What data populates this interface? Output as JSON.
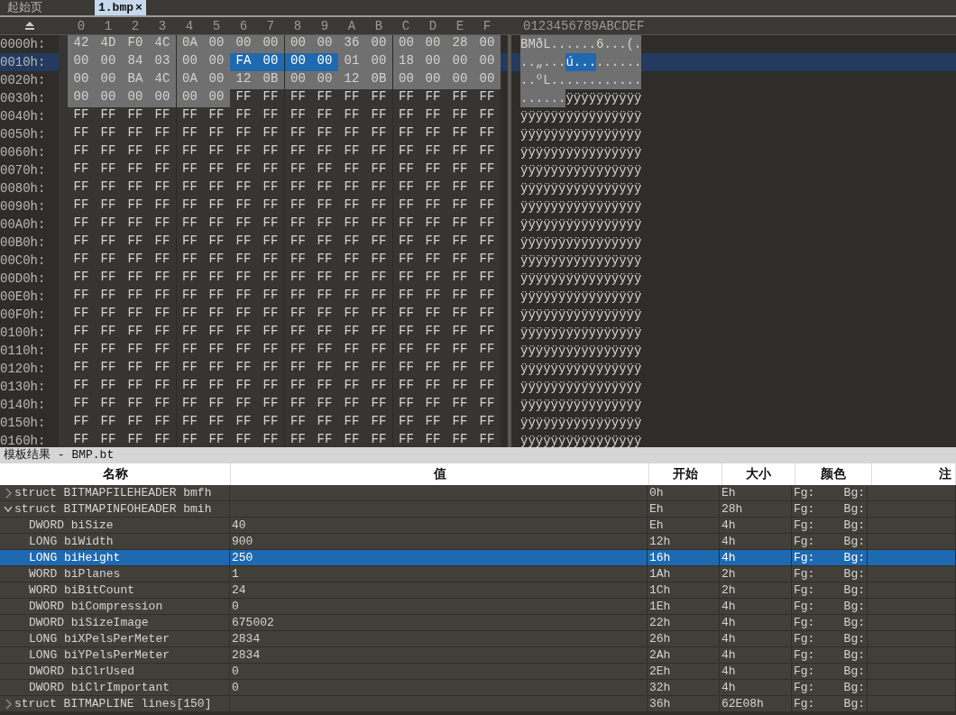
{
  "tabs": [
    {
      "label": "起始页",
      "selected": false
    },
    {
      "label": "1.bmp",
      "selected": true,
      "close": "×"
    }
  ],
  "hex_view": {
    "columns": [
      "0",
      "1",
      "2",
      "3",
      "4",
      "5",
      "6",
      "7",
      "8",
      "9",
      "A",
      "B",
      "C",
      "D",
      "E",
      "F"
    ],
    "ascii_header": "0123456789ABCDEF",
    "rows": [
      {
        "address": "0000h:",
        "current": false,
        "bytes": [
          "42",
          "4D",
          "F0",
          "4C",
          "0A",
          "00",
          "00",
          "00",
          "00",
          "00",
          "36",
          "00",
          "00",
          "00",
          "28",
          "00"
        ],
        "ascii": "BMðL......6...(.",
        "in_template": [
          true,
          true,
          true,
          true,
          true,
          true,
          true,
          true,
          true,
          true,
          true,
          true,
          true,
          true,
          true,
          true
        ],
        "selected": [
          false,
          false,
          false,
          false,
          false,
          false,
          false,
          false,
          false,
          false,
          false,
          false,
          false,
          false,
          false,
          false
        ]
      },
      {
        "address": "0010h:",
        "current": true,
        "bytes": [
          "00",
          "00",
          "84",
          "03",
          "00",
          "00",
          "FA",
          "00",
          "00",
          "00",
          "01",
          "00",
          "18",
          "00",
          "00",
          "00"
        ],
        "ascii": "..„...ú.........",
        "in_template": [
          true,
          true,
          true,
          true,
          true,
          true,
          false,
          false,
          false,
          false,
          true,
          true,
          true,
          true,
          true,
          true
        ],
        "selected": [
          false,
          false,
          false,
          false,
          false,
          false,
          true,
          true,
          true,
          true,
          false,
          false,
          false,
          false,
          false,
          false
        ]
      },
      {
        "address": "0020h:",
        "current": false,
        "bytes": [
          "00",
          "00",
          "BA",
          "4C",
          "0A",
          "00",
          "12",
          "0B",
          "00",
          "00",
          "12",
          "0B",
          "00",
          "00",
          "00",
          "00"
        ],
        "ascii": "..ºL............",
        "in_template": [
          true,
          true,
          true,
          true,
          true,
          true,
          true,
          true,
          true,
          true,
          true,
          true,
          true,
          true,
          true,
          true
        ],
        "selected": [
          false,
          false,
          false,
          false,
          false,
          false,
          false,
          false,
          false,
          false,
          false,
          false,
          false,
          false,
          false,
          false
        ]
      },
      {
        "address": "0030h:",
        "current": false,
        "bytes": [
          "00",
          "00",
          "00",
          "00",
          "00",
          "00",
          "FF",
          "FF",
          "FF",
          "FF",
          "FF",
          "FF",
          "FF",
          "FF",
          "FF",
          "FF"
        ],
        "ascii": "......ÿÿÿÿÿÿÿÿÿÿ",
        "in_template": [
          true,
          true,
          true,
          true,
          true,
          true,
          false,
          false,
          false,
          false,
          false,
          false,
          false,
          false,
          false,
          false
        ],
        "selected": [
          false,
          false,
          false,
          false,
          false,
          false,
          false,
          false,
          false,
          false,
          false,
          false,
          false,
          false,
          false,
          false
        ]
      },
      {
        "address": "0040h:",
        "current": false,
        "bytes": [
          "FF",
          "FF",
          "FF",
          "FF",
          "FF",
          "FF",
          "FF",
          "FF",
          "FF",
          "FF",
          "FF",
          "FF",
          "FF",
          "FF",
          "FF",
          "FF"
        ],
        "ascii": "ÿÿÿÿÿÿÿÿÿÿÿÿÿÿÿÿ"
      },
      {
        "address": "0050h:",
        "current": false,
        "bytes": [
          "FF",
          "FF",
          "FF",
          "FF",
          "FF",
          "FF",
          "FF",
          "FF",
          "FF",
          "FF",
          "FF",
          "FF",
          "FF",
          "FF",
          "FF",
          "FF"
        ],
        "ascii": "ÿÿÿÿÿÿÿÿÿÿÿÿÿÿÿÿ"
      },
      {
        "address": "0060h:",
        "current": false,
        "bytes": [
          "FF",
          "FF",
          "FF",
          "FF",
          "FF",
          "FF",
          "FF",
          "FF",
          "FF",
          "FF",
          "FF",
          "FF",
          "FF",
          "FF",
          "FF",
          "FF"
        ],
        "ascii": "ÿÿÿÿÿÿÿÿÿÿÿÿÿÿÿÿ"
      },
      {
        "address": "0070h:",
        "current": false,
        "bytes": [
          "FF",
          "FF",
          "FF",
          "FF",
          "FF",
          "FF",
          "FF",
          "FF",
          "FF",
          "FF",
          "FF",
          "FF",
          "FF",
          "FF",
          "FF",
          "FF"
        ],
        "ascii": "ÿÿÿÿÿÿÿÿÿÿÿÿÿÿÿÿ"
      },
      {
        "address": "0080h:",
        "current": false,
        "bytes": [
          "FF",
          "FF",
          "FF",
          "FF",
          "FF",
          "FF",
          "FF",
          "FF",
          "FF",
          "FF",
          "FF",
          "FF",
          "FF",
          "FF",
          "FF",
          "FF"
        ],
        "ascii": "ÿÿÿÿÿÿÿÿÿÿÿÿÿÿÿÿ"
      },
      {
        "address": "0090h:",
        "current": false,
        "bytes": [
          "FF",
          "FF",
          "FF",
          "FF",
          "FF",
          "FF",
          "FF",
          "FF",
          "FF",
          "FF",
          "FF",
          "FF",
          "FF",
          "FF",
          "FF",
          "FF"
        ],
        "ascii": "ÿÿÿÿÿÿÿÿÿÿÿÿÿÿÿÿ"
      },
      {
        "address": "00A0h:",
        "current": false,
        "bytes": [
          "FF",
          "FF",
          "FF",
          "FF",
          "FF",
          "FF",
          "FF",
          "FF",
          "FF",
          "FF",
          "FF",
          "FF",
          "FF",
          "FF",
          "FF",
          "FF"
        ],
        "ascii": "ÿÿÿÿÿÿÿÿÿÿÿÿÿÿÿÿ"
      },
      {
        "address": "00B0h:",
        "current": false,
        "bytes": [
          "FF",
          "FF",
          "FF",
          "FF",
          "FF",
          "FF",
          "FF",
          "FF",
          "FF",
          "FF",
          "FF",
          "FF",
          "FF",
          "FF",
          "FF",
          "FF"
        ],
        "ascii": "ÿÿÿÿÿÿÿÿÿÿÿÿÿÿÿÿ"
      },
      {
        "address": "00C0h:",
        "current": false,
        "bytes": [
          "FF",
          "FF",
          "FF",
          "FF",
          "FF",
          "FF",
          "FF",
          "FF",
          "FF",
          "FF",
          "FF",
          "FF",
          "FF",
          "FF",
          "FF",
          "FF"
        ],
        "ascii": "ÿÿÿÿÿÿÿÿÿÿÿÿÿÿÿÿ"
      },
      {
        "address": "00D0h:",
        "current": false,
        "bytes": [
          "FF",
          "FF",
          "FF",
          "FF",
          "FF",
          "FF",
          "FF",
          "FF",
          "FF",
          "FF",
          "FF",
          "FF",
          "FF",
          "FF",
          "FF",
          "FF"
        ],
        "ascii": "ÿÿÿÿÿÿÿÿÿÿÿÿÿÿÿÿ"
      },
      {
        "address": "00E0h:",
        "current": false,
        "bytes": [
          "FF",
          "FF",
          "FF",
          "FF",
          "FF",
          "FF",
          "FF",
          "FF",
          "FF",
          "FF",
          "FF",
          "FF",
          "FF",
          "FF",
          "FF",
          "FF"
        ],
        "ascii": "ÿÿÿÿÿÿÿÿÿÿÿÿÿÿÿÿ"
      },
      {
        "address": "00F0h:",
        "current": false,
        "bytes": [
          "FF",
          "FF",
          "FF",
          "FF",
          "FF",
          "FF",
          "FF",
          "FF",
          "FF",
          "FF",
          "FF",
          "FF",
          "FF",
          "FF",
          "FF",
          "FF"
        ],
        "ascii": "ÿÿÿÿÿÿÿÿÿÿÿÿÿÿÿÿ"
      },
      {
        "address": "0100h:",
        "current": false,
        "bytes": [
          "FF",
          "FF",
          "FF",
          "FF",
          "FF",
          "FF",
          "FF",
          "FF",
          "FF",
          "FF",
          "FF",
          "FF",
          "FF",
          "FF",
          "FF",
          "FF"
        ],
        "ascii": "ÿÿÿÿÿÿÿÿÿÿÿÿÿÿÿÿ"
      },
      {
        "address": "0110h:",
        "current": false,
        "bytes": [
          "FF",
          "FF",
          "FF",
          "FF",
          "FF",
          "FF",
          "FF",
          "FF",
          "FF",
          "FF",
          "FF",
          "FF",
          "FF",
          "FF",
          "FF",
          "FF"
        ],
        "ascii": "ÿÿÿÿÿÿÿÿÿÿÿÿÿÿÿÿ"
      },
      {
        "address": "0120h:",
        "current": false,
        "bytes": [
          "FF",
          "FF",
          "FF",
          "FF",
          "FF",
          "FF",
          "FF",
          "FF",
          "FF",
          "FF",
          "FF",
          "FF",
          "FF",
          "FF",
          "FF",
          "FF"
        ],
        "ascii": "ÿÿÿÿÿÿÿÿÿÿÿÿÿÿÿÿ"
      },
      {
        "address": "0130h:",
        "current": false,
        "bytes": [
          "FF",
          "FF",
          "FF",
          "FF",
          "FF",
          "FF",
          "FF",
          "FF",
          "FF",
          "FF",
          "FF",
          "FF",
          "FF",
          "FF",
          "FF",
          "FF"
        ],
        "ascii": "ÿÿÿÿÿÿÿÿÿÿÿÿÿÿÿÿ"
      },
      {
        "address": "0140h:",
        "current": false,
        "bytes": [
          "FF",
          "FF",
          "FF",
          "FF",
          "FF",
          "FF",
          "FF",
          "FF",
          "FF",
          "FF",
          "FF",
          "FF",
          "FF",
          "FF",
          "FF",
          "FF"
        ],
        "ascii": "ÿÿÿÿÿÿÿÿÿÿÿÿÿÿÿÿ"
      },
      {
        "address": "0150h:",
        "current": false,
        "bytes": [
          "FF",
          "FF",
          "FF",
          "FF",
          "FF",
          "FF",
          "FF",
          "FF",
          "FF",
          "FF",
          "FF",
          "FF",
          "FF",
          "FF",
          "FF",
          "FF"
        ],
        "ascii": "ÿÿÿÿÿÿÿÿÿÿÿÿÿÿÿÿ"
      },
      {
        "address": "0160h:",
        "current": false,
        "bytes": [
          "FF",
          "FF",
          "FF",
          "FF",
          "FF",
          "FF",
          "FF",
          "FF",
          "FF",
          "FF",
          "FF",
          "FF",
          "FF",
          "FF",
          "FF",
          "FF"
        ],
        "ascii": "ÿÿÿÿÿÿÿÿÿÿÿÿÿÿÿÿ"
      }
    ]
  },
  "template_results": {
    "title": "模板结果 - BMP.bt",
    "columns": [
      "名称",
      "值",
      "开始",
      "大小",
      "颜色",
      "注"
    ],
    "rows": [
      {
        "name": "struct BITMAPFILEHEADER bmfh",
        "expanded": false,
        "selected": false,
        "start": "0h",
        "size": "Eh",
        "fg": "Fg:",
        "bg": "Bg:"
      },
      {
        "name": "struct BITMAPINFOHEADER bmih",
        "expanded": true,
        "selected": false,
        "start": "Eh",
        "size": "28h",
        "fg": "Fg:",
        "bg": "Bg:",
        "children": [
          {
            "name": "DWORD biSize",
            "value": "40",
            "selected": false,
            "start": "Eh",
            "size": "4h",
            "fg": "Fg:",
            "bg": "Bg:"
          },
          {
            "name": "LONG biWidth",
            "value": "900",
            "selected": false,
            "start": "12h",
            "size": "4h",
            "fg": "Fg:",
            "bg": "Bg:"
          },
          {
            "name": "LONG biHeight",
            "value": "250",
            "selected": true,
            "start": "16h",
            "size": "4h",
            "fg": "Fg:",
            "bg": "Bg:"
          },
          {
            "name": "WORD biPlanes",
            "value": "1",
            "selected": false,
            "start": "1Ah",
            "size": "2h",
            "fg": "Fg:",
            "bg": "Bg:"
          },
          {
            "name": "WORD biBitCount",
            "value": "24",
            "selected": false,
            "start": "1Ch",
            "size": "2h",
            "fg": "Fg:",
            "bg": "Bg:"
          },
          {
            "name": "DWORD biCompression",
            "value": "0",
            "selected": false,
            "start": "1Eh",
            "size": "4h",
            "fg": "Fg:",
            "bg": "Bg:"
          },
          {
            "name": "DWORD biSizeImage",
            "value": "675002",
            "selected": false,
            "start": "22h",
            "size": "4h",
            "fg": "Fg:",
            "bg": "Bg:"
          },
          {
            "name": "LONG biXPelsPerMeter",
            "value": "2834",
            "selected": false,
            "start": "26h",
            "size": "4h",
            "fg": "Fg:",
            "bg": "Bg:"
          },
          {
            "name": "LONG biYPelsPerMeter",
            "value": "2834",
            "selected": false,
            "start": "2Ah",
            "size": "4h",
            "fg": "Fg:",
            "bg": "Bg:"
          },
          {
            "name": "DWORD biClrUsed",
            "value": "0",
            "selected": false,
            "start": "2Eh",
            "size": "4h",
            "fg": "Fg:",
            "bg": "Bg:"
          },
          {
            "name": "DWORD biClrImportant",
            "value": "0",
            "selected": false,
            "start": "32h",
            "size": "4h",
            "fg": "Fg:",
            "bg": "Bg:"
          }
        ]
      },
      {
        "name": "struct BITMAPLINE lines[150]",
        "expanded": false,
        "selected": false,
        "start": "36h",
        "size": "62E08h",
        "fg": "Fg:",
        "bg": "Bg:"
      }
    ]
  }
}
